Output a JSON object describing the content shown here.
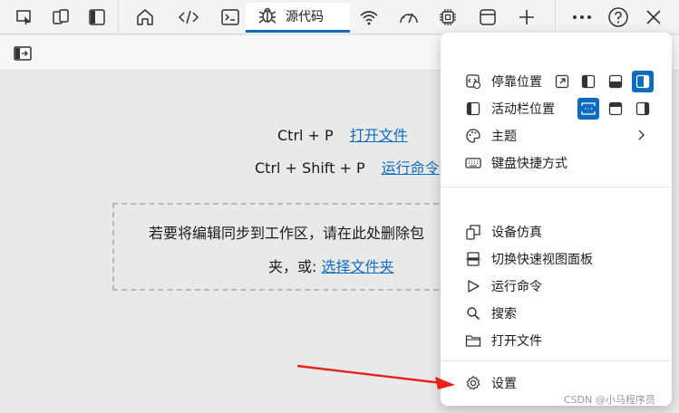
{
  "toolbar": {
    "icons": [
      "inspect-icon",
      "device-icon",
      "dock-panel-icon",
      "home-icon",
      "elements-icon",
      "console-icon",
      "sources-bug-icon",
      "network-wifi-icon",
      "performance-icon",
      "memory-chip-icon",
      "application-icon",
      "add-tool-icon",
      "more-icon",
      "help-icon",
      "close-icon"
    ],
    "active_tab_label": "源代码"
  },
  "main": {
    "shortcut_open": {
      "keys": "Ctrl + P",
      "action": "打开文件"
    },
    "shortcut_run": {
      "keys": "Ctrl + Shift + P",
      "action": "运行命令"
    },
    "dropzone": {
      "line1": "若要将编辑同步到工作区，请在此处删除包",
      "line2_prefix": "夹，或: ",
      "line2_link": "选择文件夹"
    }
  },
  "menu": {
    "dock_position_label": "停靠位置",
    "activity_bar_label": "活动栏位置",
    "theme_label": "主题",
    "keyboard_label": "键盘快捷方式",
    "device_emulation_label": "设备仿真",
    "quick_view_label": "切换快速视图面板",
    "run_command_label": "运行命令",
    "search_label": "搜索",
    "open_file_label": "打开文件",
    "settings_label": "设置"
  },
  "colors": {
    "accent": "#0f6cbd",
    "arrow": "#e5231b"
  },
  "watermark": "CSDN @小马程序员"
}
